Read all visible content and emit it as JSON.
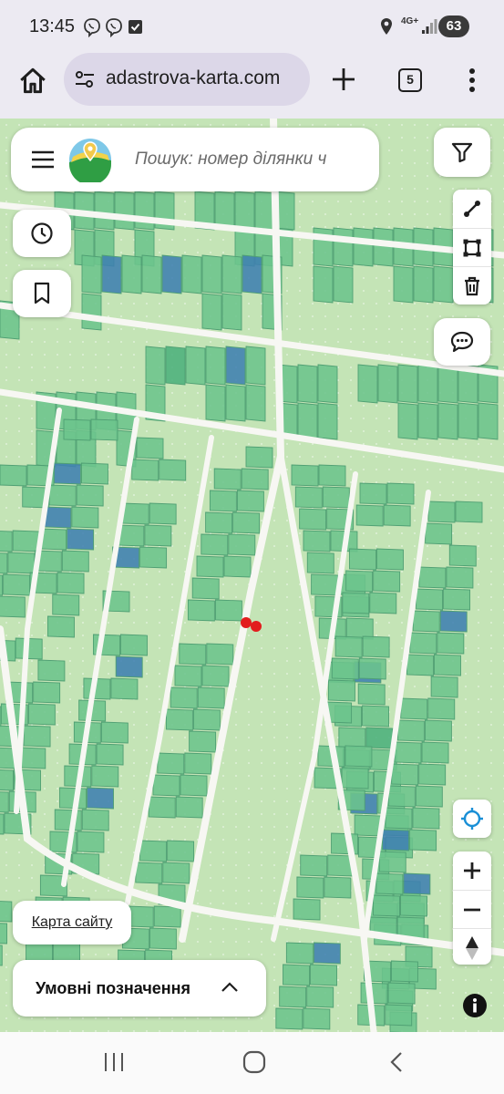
{
  "status_bar": {
    "time": "13:45",
    "network": "4G+",
    "battery": "63",
    "icons": [
      "viber-icon",
      "viber-icon",
      "checkbox-icon",
      "location-icon",
      "signal-icon"
    ]
  },
  "browser": {
    "url": "adastrova-karta.com",
    "tab_count": "5"
  },
  "search": {
    "placeholder": "Пошук: номер ділянки ч"
  },
  "map_buttons": {
    "sitemap_label": "Карта сайту",
    "legend_label": "Умовні позначення"
  },
  "colors": {
    "parcel": "#6cc48c",
    "parcel_dark": "#3f7fb0",
    "road": "#f7f7f3",
    "background": "#bfe0b2",
    "marker": "#e21d1d"
  }
}
